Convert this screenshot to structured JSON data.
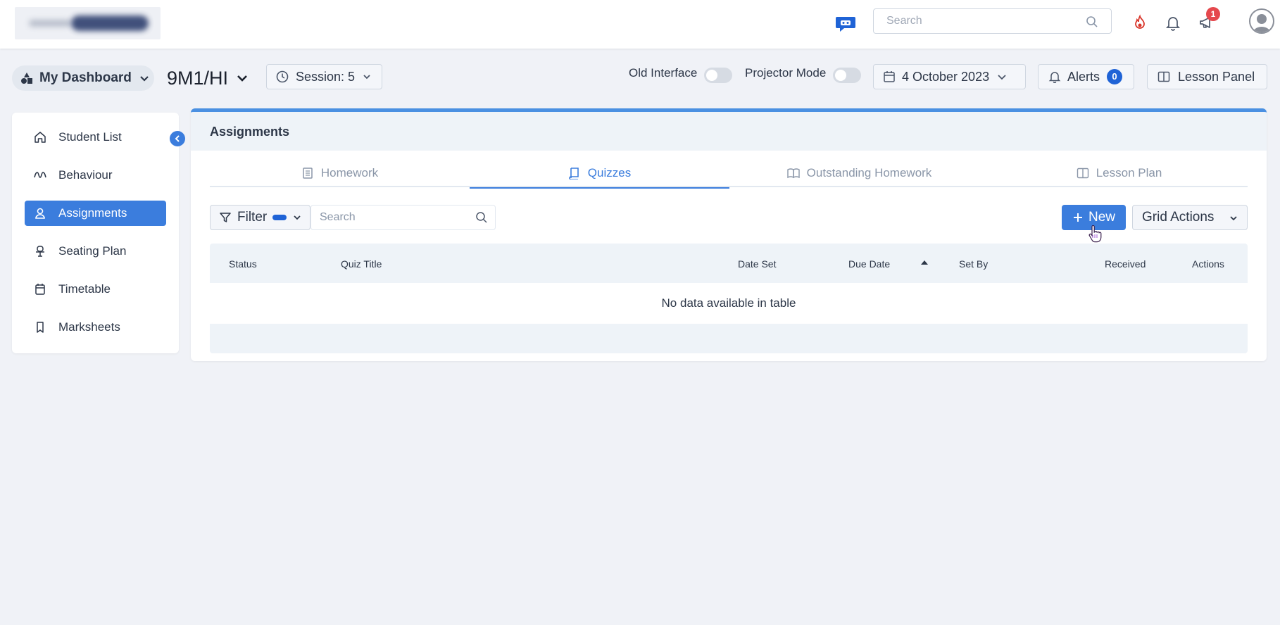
{
  "topbar": {
    "search_placeholder": "Search",
    "notification_count": "1"
  },
  "subheader": {
    "dashboard_label": "My Dashboard",
    "class_label": "9M1/HI",
    "session_label": "Session: 5",
    "old_interface_label": "Old Interface",
    "projector_mode_label": "Projector Mode",
    "date_label": "4 October 2023",
    "alerts_label": "Alerts",
    "alerts_count": "0",
    "lesson_panel_label": "Lesson Panel"
  },
  "sidebar": {
    "items": [
      {
        "label": "Student List",
        "icon": "home-icon"
      },
      {
        "label": "Behaviour",
        "icon": "behaviour-icon"
      },
      {
        "label": "Assignments",
        "icon": "user-icon",
        "active": true
      },
      {
        "label": "Seating Plan",
        "icon": "chair-icon"
      },
      {
        "label": "Timetable",
        "icon": "calendar-icon"
      },
      {
        "label": "Marksheets",
        "icon": "bookmark-icon"
      }
    ]
  },
  "panel": {
    "title": "Assignments",
    "tabs": [
      {
        "label": "Homework",
        "icon": "document-icon"
      },
      {
        "label": "Quizzes",
        "icon": "book-icon",
        "active": true
      },
      {
        "label": "Outstanding Homework",
        "icon": "open-book-icon"
      },
      {
        "label": "Lesson Plan",
        "icon": "columns-icon"
      }
    ],
    "filter_label": "Filter",
    "search_placeholder": "Search",
    "new_label": "New",
    "grid_actions_label": "Grid Actions",
    "columns": [
      "Status",
      "Quiz Title",
      "Date Set",
      "Due Date",
      "Set By",
      "Received",
      "Actions"
    ],
    "empty_message": "No data available in table"
  },
  "colors": {
    "accent": "#3b7ddd",
    "badge_red": "#e5484d",
    "badge_blue": "#1f63d6"
  }
}
